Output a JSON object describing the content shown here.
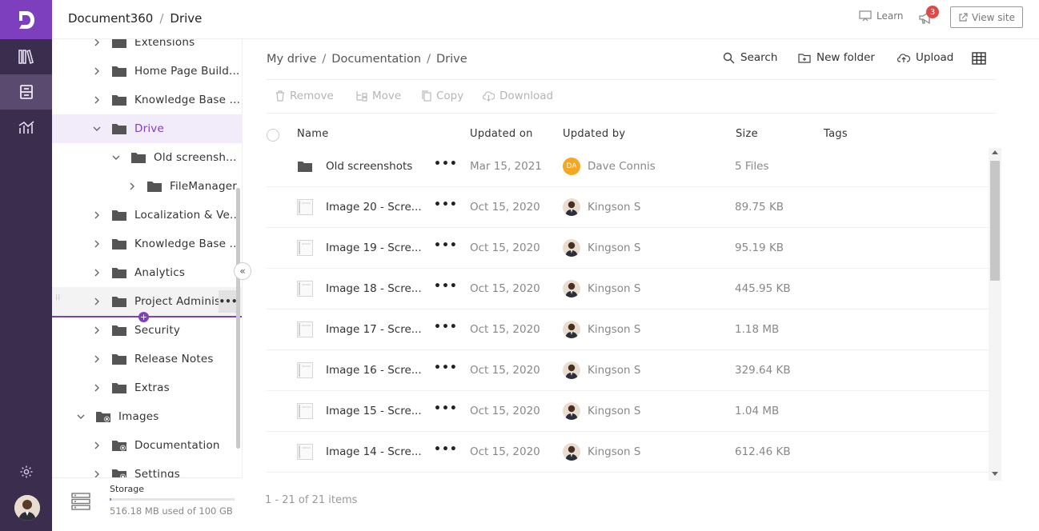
{
  "header": {
    "app_name": "Document360",
    "section": "Drive",
    "learn_label": "Learn",
    "notification_count": "3",
    "view_site_label": "View site"
  },
  "sidebar": {
    "items": [
      {
        "label": "Extensions",
        "level": 1,
        "expanded": false
      },
      {
        "label": "Home Page Build...",
        "level": 1,
        "expanded": false
      },
      {
        "label": "Knowledge Base ...",
        "level": 1,
        "expanded": false
      },
      {
        "label": "Drive",
        "level": 1,
        "expanded": true,
        "active": true
      },
      {
        "label": "Old screensh...",
        "level": 2,
        "expanded": true
      },
      {
        "label": "FileManager",
        "level": 3,
        "expanded": false
      },
      {
        "label": "Localization & Ve...",
        "level": 1,
        "expanded": false
      },
      {
        "label": "Knowledge Base ...",
        "level": 1,
        "expanded": false
      },
      {
        "label": "Analytics",
        "level": 1,
        "expanded": false
      },
      {
        "label": "Project Adminis",
        "level": 1,
        "expanded": false,
        "hover": true
      },
      {
        "label": "Security",
        "level": 1,
        "expanded": false
      },
      {
        "label": "Release Notes",
        "level": 1,
        "expanded": false
      },
      {
        "label": "Extras",
        "level": 1,
        "expanded": false
      },
      {
        "label": "Images",
        "level": 0,
        "expanded": true,
        "shared": true
      },
      {
        "label": "Documentation",
        "level": 1,
        "expanded": false,
        "shared": true
      },
      {
        "label": "Settings",
        "level": 1,
        "expanded": false,
        "shared": true
      }
    ],
    "storage": {
      "title": "Storage",
      "used_text": "516.18 MB used of 100 GB",
      "used_fraction": 0.005
    }
  },
  "main": {
    "breadcrumb": [
      "My drive",
      "Documentation",
      "Drive"
    ],
    "actions": {
      "search": "Search",
      "new_folder": "New folder",
      "upload": "Upload"
    },
    "toolbar": {
      "remove": "Remove",
      "move": "Move",
      "copy": "Copy",
      "download": "Download"
    },
    "columns": {
      "name": "Name",
      "updated_on": "Updated on",
      "updated_by": "Updated by",
      "size": "Size",
      "tags": "Tags"
    },
    "rows": [
      {
        "type": "folder",
        "name": "Old screenshots",
        "date": "Mar 15, 2021",
        "user": "Dave Connis",
        "initials": "DA",
        "size": "5 Files"
      },
      {
        "type": "file",
        "name": "Image 20 - Scre...",
        "date": "Oct 15, 2020",
        "user": "Kingson S",
        "size": "89.75 KB"
      },
      {
        "type": "file",
        "name": "Image 19 - Scre...",
        "date": "Oct 15, 2020",
        "user": "Kingson S",
        "size": "95.19 KB"
      },
      {
        "type": "file",
        "name": "Image 18 - Scre...",
        "date": "Oct 15, 2020",
        "user": "Kingson S",
        "size": "445.95 KB"
      },
      {
        "type": "file",
        "name": "Image 17 - Scre...",
        "date": "Oct 15, 2020",
        "user": "Kingson S",
        "size": "1.18 MB"
      },
      {
        "type": "file",
        "name": "Image 16 - Scre...",
        "date": "Oct 15, 2020",
        "user": "Kingson S",
        "size": "329.64 KB"
      },
      {
        "type": "file",
        "name": "Image 15 - Scre...",
        "date": "Oct 15, 2020",
        "user": "Kingson S",
        "size": "1.04 MB"
      },
      {
        "type": "file",
        "name": "Image 14 - Scre...",
        "date": "Oct 15, 2020",
        "user": "Kingson S",
        "size": "612.46 KB"
      }
    ],
    "pager": "1 - 21 of 21 items"
  },
  "colors": {
    "brand": "#7e3fbe",
    "rail": "#3b2d4d",
    "active_bg": "#f2ebf9"
  }
}
